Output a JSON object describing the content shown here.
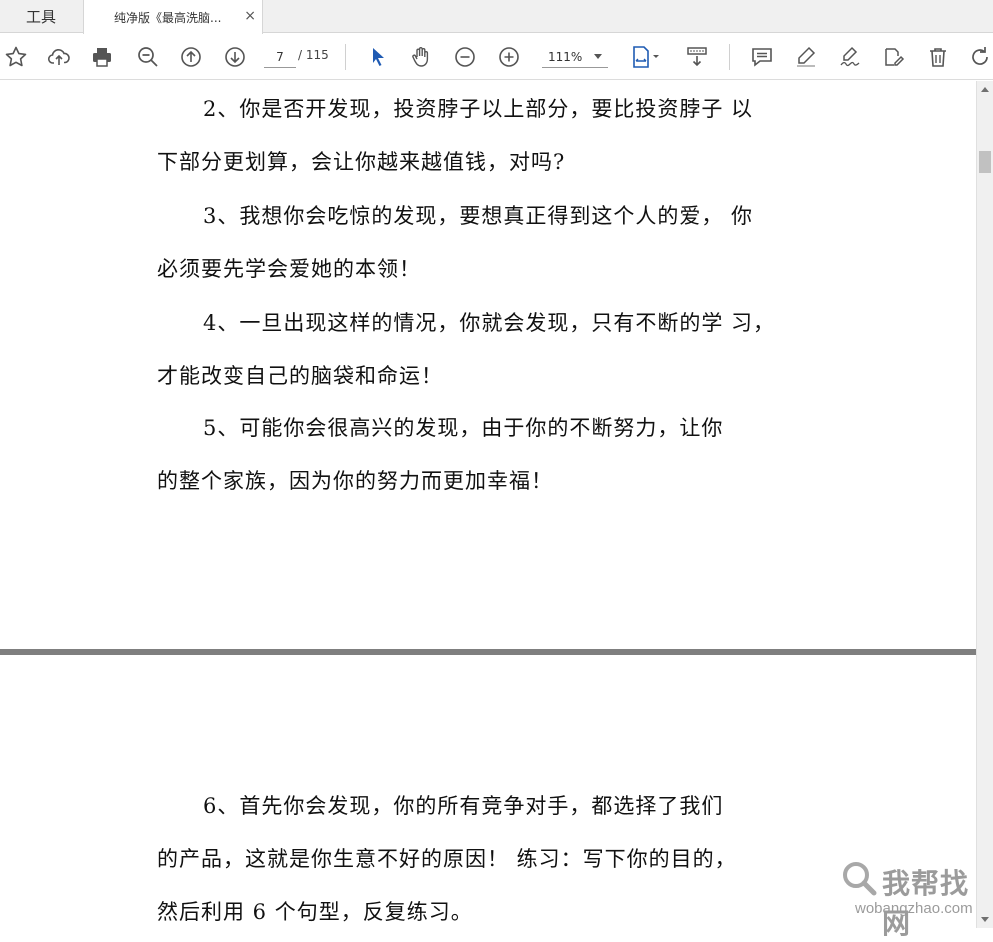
{
  "tabs": {
    "tools_label": "工具",
    "doc_label": "纯净版《最高洗脑...",
    "close_glyph": "×"
  },
  "toolbar": {
    "current_page": "7",
    "total_pages": "/ 115",
    "zoom": "111%",
    "icons": [
      "star-icon",
      "cloud-upload-icon",
      "printer-icon",
      "zoom-out-magnifier-icon",
      "page-up-icon",
      "page-down-icon",
      "select-arrow-icon",
      "hand-icon",
      "zoom-minus-icon",
      "zoom-plus-icon",
      "fit-page-icon",
      "scroll-mode-icon",
      "comment-icon",
      "highlight-pen-icon",
      "signature-icon",
      "edit-text-icon",
      "trash-icon",
      "rotate-icon"
    ],
    "accent_color": "#1f5bb3"
  },
  "document": {
    "paragraphs": [
      {
        "lines": [
          "2、你是否开发现，投资脖子以上部分，要比投资脖子  以",
          "下部分更划算，会让你越来越值钱，对吗?"
        ]
      },
      {
        "lines": [
          "3、我想你会吃惊的发现，要想真正得到这个人的爱，  你",
          "必须要先学会爱她的本领！"
        ]
      },
      {
        "lines": [
          "4、一旦出现这样的情况，你就会发现，只有不断的学  习，",
          "才能改变自己的脑袋和命运！"
        ]
      },
      {
        "lines": [
          "5、可能你会很高兴的发现，由于你的不断努力，让你",
          "的整个家族，因为你的努力而更加幸福！"
        ]
      },
      {
        "lines": [
          "6、首先你会发现，你的所有竞争对手，都选择了我们",
          "的产品，这就是你生意不好的原因！  练习：写下你的目的，",
          "然后利用  6 个句型，反复练习。"
        ]
      }
    ]
  },
  "watermark": {
    "text": "我帮找网",
    "url": "wobangzhao.com"
  }
}
